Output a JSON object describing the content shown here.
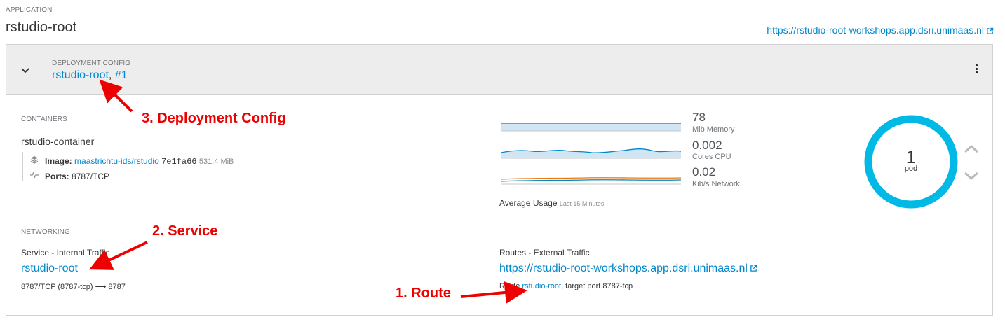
{
  "application": {
    "label": "APPLICATION",
    "name": "rstudio-root",
    "route_url": "https://rstudio-root-workshops.app.dsri.unimaas.nl"
  },
  "deployment": {
    "label": "DEPLOYMENT CONFIG",
    "name": "rstudio-root",
    "sep": ", ",
    "revision": "#1"
  },
  "containers": {
    "label": "CONTAINERS",
    "name": "rstudio-container",
    "image_label": "Image:",
    "image_repo": "maastrichtu-ids/rstudio",
    "image_hash": "7e1fa66",
    "image_size": "531.4 MiB",
    "ports_label": "Ports:",
    "ports_value": "8787/TCP"
  },
  "metrics": {
    "memory_value": "78",
    "memory_unit": "Mib Memory",
    "cpu_value": "0.002",
    "cpu_unit": "Cores CPU",
    "network_value": "0.02",
    "network_unit": "Kib/s Network",
    "avg_label": "Average Usage",
    "avg_period": "Last 15 Minutes"
  },
  "pods": {
    "count": "1",
    "label": "pod"
  },
  "networking": {
    "label": "NETWORKING",
    "service_title": "Service - Internal Traffic",
    "service_name": "rstudio-root",
    "service_ports": "8787/TCP (8787-tcp) ⟶ 8787",
    "routes_title": "Routes - External Traffic",
    "route_url": "https://rstudio-root-workshops.app.dsri.unimaas.nl",
    "route_prefix": "Route",
    "route_name": "rstudio-root",
    "route_suffix": ", target port 8787-tcp"
  },
  "annotations": {
    "route": "1. Route",
    "service": "2. Service",
    "deployment": "3. Deployment Config"
  },
  "colors": {
    "link": "#0088ce",
    "donut": "#00b9e4",
    "annotation": "#ee0000",
    "network_out": "#ec7a08"
  }
}
